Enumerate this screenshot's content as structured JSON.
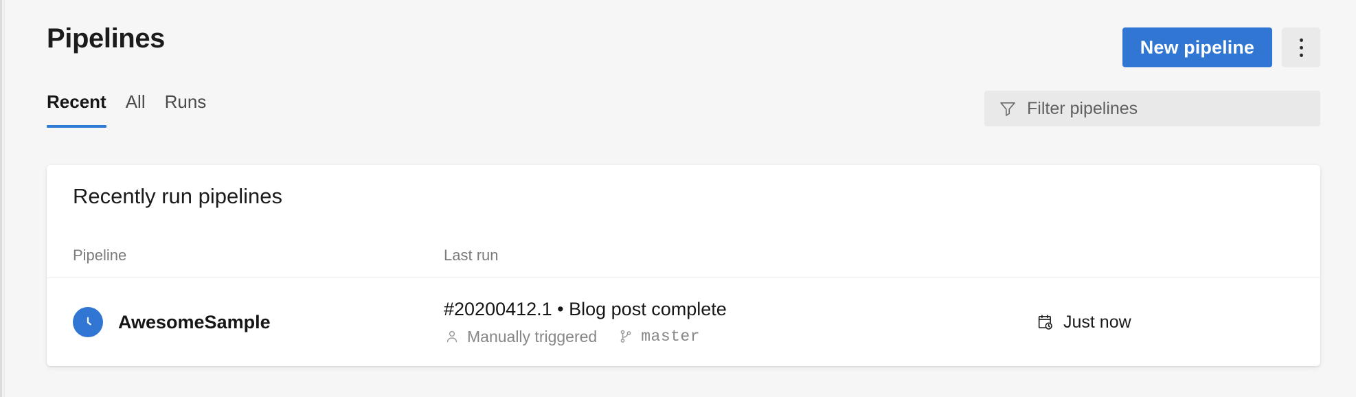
{
  "header": {
    "title": "Pipelines",
    "new_pipeline_label": "New pipeline",
    "more_actions_icon": "kebab-menu-icon",
    "primary_color": "#3076d2"
  },
  "subnav": {
    "tabs": [
      {
        "label": "Recent",
        "active": true
      },
      {
        "label": "All",
        "active": false
      },
      {
        "label": "Runs",
        "active": false
      }
    ],
    "active_tab_indicator_color": "#2f7bd4",
    "filter": {
      "icon": "filter-funnel-icon",
      "value": "",
      "placeholder": "Filter pipelines"
    }
  },
  "card": {
    "title": "Recently run pipelines",
    "columns": {
      "pipeline": "Pipeline",
      "last_run": "Last run"
    },
    "rows": [
      {
        "status_icon": "clock-icon",
        "status_color": "#3076d2",
        "pipeline_name": "AwesomeSample",
        "run_title": "#20200412.1 • Blog post complete",
        "trigger_icon": "person-icon",
        "trigger_text": "Manually triggered",
        "branch_icon": "branch-icon",
        "branch_name": "master",
        "time_icon": "calendar-clock-icon",
        "time_text": "Just now"
      }
    ]
  }
}
